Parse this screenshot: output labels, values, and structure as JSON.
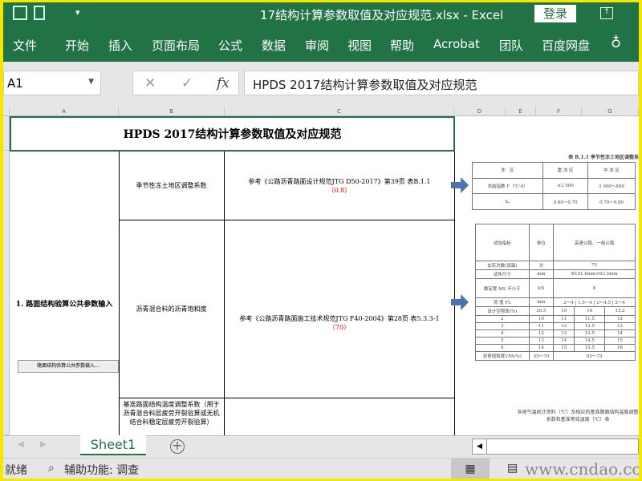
{
  "window": {
    "title": "17结构计算参数取值及对应规范.xlsx  -  Excel",
    "login": "登录",
    "quick_access": "▾"
  },
  "ribbon": {
    "tabs": [
      "文件",
      "开始",
      "插入",
      "页面布局",
      "公式",
      "数据",
      "审阅",
      "视图",
      "帮助",
      "Acrobat",
      "团队",
      "百度网盘"
    ],
    "tell_me_icon": "lightbulb-icon"
  },
  "formula_bar": {
    "name_box": "A1",
    "cancel": "✕",
    "enter": "✓",
    "fx": "fx",
    "value": "HPDS 2017结构计算参数取值及对应规范"
  },
  "columns": [
    "A",
    "B",
    "C",
    "D",
    "E",
    "F",
    "G"
  ],
  "sheet": {
    "title": "HPDS 2017结构计算参数取值及对应规范",
    "section": "1. 路面结构验算公共参数输入",
    "section_button": "路面结构验算公共参数输入...",
    "rows": [
      {
        "param": "季节性冻土地区调整系数",
        "ref": "参考《公路沥青路面设计规范JTG D50-2017》第39页 表B.1.1",
        "value": "（0.8）"
      },
      {
        "param": "沥青混合料的沥青饱和度",
        "ref": "参考《公路沥青路面施工技术规范JTG F40-2004》第28页 表5.3.3-1",
        "value": "（70）"
      },
      {
        "param": "基准路面结构温度调整系数（用于沥青混合料层疲劳开裂验算或无机结合料稳定层疲劳开裂验算）",
        "ref": "",
        "value": ""
      }
    ]
  },
  "ref_table1": {
    "caption": "表 B.1.1  季节性冻土地区调整系",
    "headers": [
      "冻　区",
      "重 冻 区",
      "中 冻 区"
    ],
    "rows": [
      [
        "冻结指数 F（℃·d）",
        "≥2 000",
        "2 000～800"
      ],
      [
        "kₐ",
        "0.60～0.70",
        "0.70～0.80"
      ]
    ]
  },
  "ref_table2": {
    "header": [
      "试验指标",
      "单位",
      "高速公路、一级公路"
    ],
    "rows": [
      [
        "击实次数(双面)",
        "次",
        "75"
      ],
      [
        "试件尺寸",
        "mm",
        "Φ101.6mm×63.5mm"
      ],
      [
        "稳定度 MS 不小于",
        "kN",
        "8"
      ],
      [
        "流 值 FL",
        "mm",
        "2～4 | 1.5～4 | 2～4.5 | 2～4"
      ]
    ],
    "vma_header": [
      "设计空隙率(%)",
      "26.5",
      "19",
      "16",
      "13.2"
    ],
    "vma_rows": [
      [
        "2",
        "10",
        "11",
        "11.5",
        "12"
      ],
      [
        "3",
        "11",
        "12",
        "12.5",
        "13"
      ],
      [
        "4",
        "12",
        "13",
        "13.5",
        "14"
      ],
      [
        "5",
        "13",
        "14",
        "14.5",
        "15"
      ],
      [
        "6",
        "14",
        "15",
        "15.5",
        "16"
      ]
    ],
    "vfa": [
      "沥青饱和度VFA(%)",
      "55～70",
      "65～75"
    ]
  },
  "ref_table3": {
    "caption": "各地气温统计资料（℃）及相应的基准路面结构温度调整系数和基准等效温度（℃）表"
  },
  "sheet_tabs": [
    "Sheet1"
  ],
  "status": {
    "ready": "就绪",
    "accessibility": "辅助功能: 调查"
  },
  "watermark": "www.cndao.com",
  "colors": {
    "excel_green": "#217346",
    "frame": "#f5e600",
    "arrow": "#4a74b0"
  }
}
